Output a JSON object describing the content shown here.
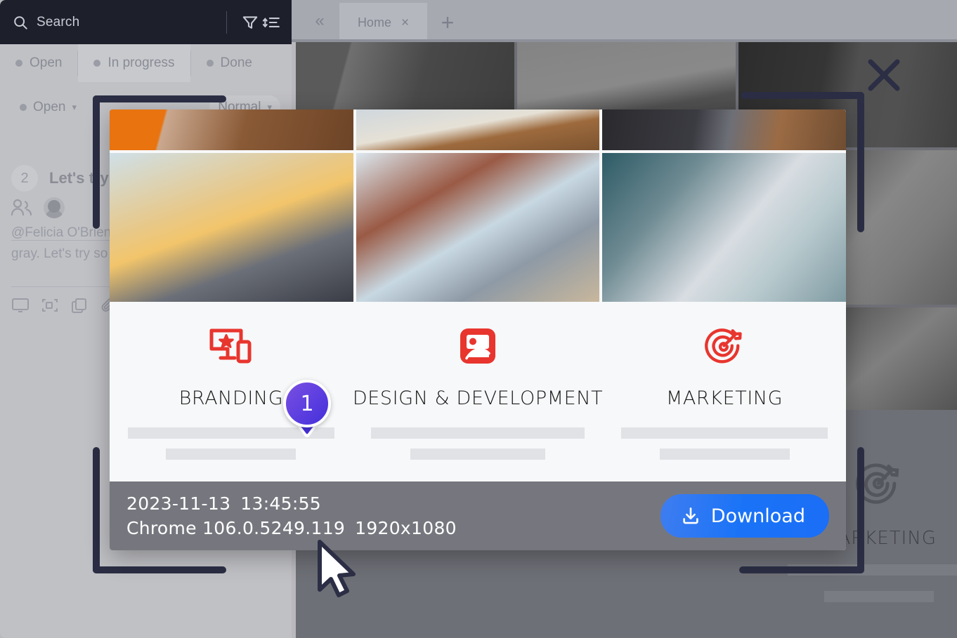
{
  "app": {
    "search": {
      "placeholder": "Search",
      "value": "",
      "icon": "search-icon"
    },
    "toolbar": {
      "filter_icon": "filter-icon",
      "sort_icon": "sort-icon"
    }
  },
  "browser": {
    "collapse_label": "«",
    "tabs": [
      {
        "label": "Home",
        "close": "×",
        "active": true
      }
    ],
    "new_tab_label": "+"
  },
  "task_panel": {
    "status_tabs": [
      {
        "label": "Open",
        "active": false
      },
      {
        "label": "In progress",
        "active": true
      },
      {
        "label": "Done",
        "active": false
      }
    ],
    "status_select": "Open",
    "priority_select": "Normal",
    "comment_count": "2",
    "title": "Let's try a d",
    "body_line1": "@Felicia O'Brien,",
    "body_line2": "gray. Let's try so",
    "attachment_count": "0",
    "action_icons": [
      "monitor-icon",
      "crop-icon",
      "copy-icon",
      "paperclip-icon"
    ]
  },
  "modal": {
    "photos": [
      {
        "name": "photo-desk-notebook"
      },
      {
        "name": "photo-laptop-pencils"
      },
      {
        "name": "photo-suit-closeup"
      },
      {
        "name": "photo-two-women-office"
      },
      {
        "name": "photo-highfive-meeting"
      },
      {
        "name": "photo-woman-phone-desk"
      }
    ],
    "services": [
      {
        "label": "BRANDING",
        "icon": "monitor-star-mobile-icon",
        "icon_color": "#e8352e",
        "badge": {
          "value": "1",
          "color": "#5339dd"
        }
      },
      {
        "label": "DESIGN & DEVELOPMENT",
        "icon": "image-placeholder-icon",
        "icon_color": "#e8352e"
      },
      {
        "label": "MARKETING",
        "icon": "target-dart-icon",
        "icon_color": "#e8352e"
      }
    ],
    "footer": {
      "date": "2023-11-13",
      "time": "13:45:55",
      "browser": "Chrome 106.0.5249.119",
      "resolution": "1920x1080",
      "download_label": "Download",
      "download_icon": "download-icon",
      "download_color": "#1a73f7"
    }
  },
  "background_page": {
    "service_label": "MARKETING",
    "service_icon": "target-dart-icon"
  },
  "overlay": {
    "close_icon": "close-icon",
    "bracket_color": "#2b2e44",
    "cursor_icon": "mouse-cursor"
  }
}
